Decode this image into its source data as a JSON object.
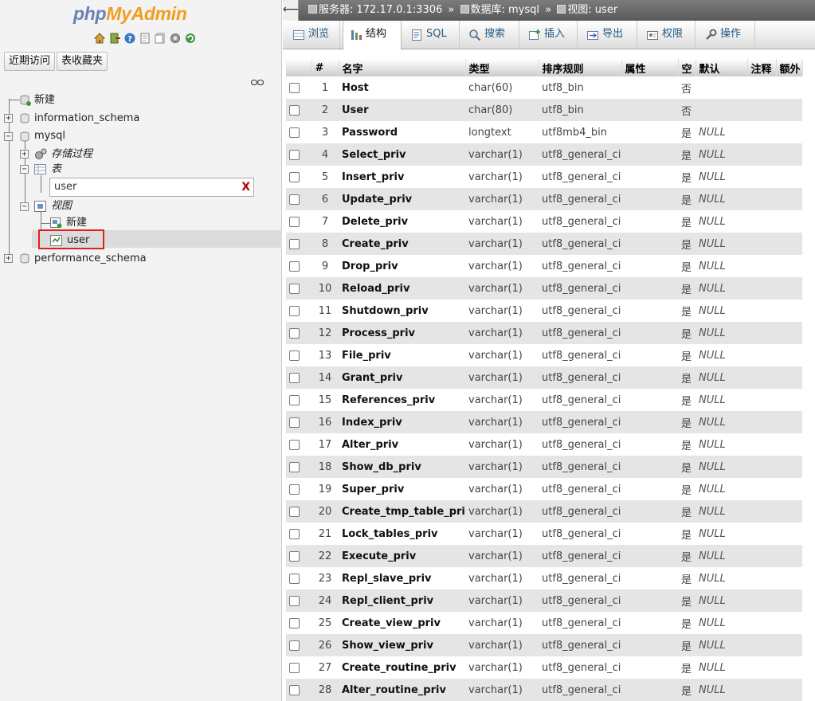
{
  "logo": {
    "part1": "php",
    "part2": "MyAdmin"
  },
  "nav_icons": [
    "home-icon",
    "exit-icon",
    "help-icon",
    "docs-icon",
    "sql-docs-icon",
    "settings-icon",
    "reload-icon"
  ],
  "quick_buttons": {
    "recent": "近期访问",
    "favorites": "表收藏夹"
  },
  "tree": {
    "new_db": "新建",
    "db_information_schema": "information_schema",
    "db_mysql": "mysql",
    "procedures": "存储过程",
    "tables": "表",
    "filter_value": "user",
    "filter_clear": "X",
    "views": "视图",
    "new_view": "新建",
    "view_user": "user",
    "db_performance_schema": "performance_schema"
  },
  "breadcrumb": {
    "server": "服务器: 172.17.0.1:3306",
    "database": "数据库: mysql",
    "view": "视图: user",
    "separator": "»"
  },
  "tabs": [
    {
      "label": "浏览",
      "icon": "browse-icon"
    },
    {
      "label": "结构",
      "icon": "structure-icon",
      "active": true
    },
    {
      "label": "SQL",
      "icon": "sql-icon"
    },
    {
      "label": "搜索",
      "icon": "search-icon"
    },
    {
      "label": "插入",
      "icon": "insert-icon"
    },
    {
      "label": "导出",
      "icon": "export-icon"
    },
    {
      "label": "权限",
      "icon": "privileges-icon"
    },
    {
      "label": "操作",
      "icon": "operations-icon"
    }
  ],
  "table_headers": [
    "#",
    "名字",
    "类型",
    "排序规则",
    "属性",
    "空",
    "默认",
    "注释",
    "额外"
  ],
  "rows": [
    {
      "n": "1",
      "name": "Host",
      "type": "char(60)",
      "collation": "utf8_bin",
      "null": "否",
      "default": ""
    },
    {
      "n": "2",
      "name": "User",
      "type": "char(80)",
      "collation": "utf8_bin",
      "null": "否",
      "default": ""
    },
    {
      "n": "3",
      "name": "Password",
      "type": "longtext",
      "collation": "utf8mb4_bin",
      "null": "是",
      "default": "NULL"
    },
    {
      "n": "4",
      "name": "Select_priv",
      "type": "varchar(1)",
      "collation": "utf8_general_ci",
      "null": "是",
      "default": "NULL"
    },
    {
      "n": "5",
      "name": "Insert_priv",
      "type": "varchar(1)",
      "collation": "utf8_general_ci",
      "null": "是",
      "default": "NULL"
    },
    {
      "n": "6",
      "name": "Update_priv",
      "type": "varchar(1)",
      "collation": "utf8_general_ci",
      "null": "是",
      "default": "NULL"
    },
    {
      "n": "7",
      "name": "Delete_priv",
      "type": "varchar(1)",
      "collation": "utf8_general_ci",
      "null": "是",
      "default": "NULL"
    },
    {
      "n": "8",
      "name": "Create_priv",
      "type": "varchar(1)",
      "collation": "utf8_general_ci",
      "null": "是",
      "default": "NULL"
    },
    {
      "n": "9",
      "name": "Drop_priv",
      "type": "varchar(1)",
      "collation": "utf8_general_ci",
      "null": "是",
      "default": "NULL"
    },
    {
      "n": "10",
      "name": "Reload_priv",
      "type": "varchar(1)",
      "collation": "utf8_general_ci",
      "null": "是",
      "default": "NULL"
    },
    {
      "n": "11",
      "name": "Shutdown_priv",
      "type": "varchar(1)",
      "collation": "utf8_general_ci",
      "null": "是",
      "default": "NULL"
    },
    {
      "n": "12",
      "name": "Process_priv",
      "type": "varchar(1)",
      "collation": "utf8_general_ci",
      "null": "是",
      "default": "NULL"
    },
    {
      "n": "13",
      "name": "File_priv",
      "type": "varchar(1)",
      "collation": "utf8_general_ci",
      "null": "是",
      "default": "NULL"
    },
    {
      "n": "14",
      "name": "Grant_priv",
      "type": "varchar(1)",
      "collation": "utf8_general_ci",
      "null": "是",
      "default": "NULL"
    },
    {
      "n": "15",
      "name": "References_priv",
      "type": "varchar(1)",
      "collation": "utf8_general_ci",
      "null": "是",
      "default": "NULL"
    },
    {
      "n": "16",
      "name": "Index_priv",
      "type": "varchar(1)",
      "collation": "utf8_general_ci",
      "null": "是",
      "default": "NULL"
    },
    {
      "n": "17",
      "name": "Alter_priv",
      "type": "varchar(1)",
      "collation": "utf8_general_ci",
      "null": "是",
      "default": "NULL"
    },
    {
      "n": "18",
      "name": "Show_db_priv",
      "type": "varchar(1)",
      "collation": "utf8_general_ci",
      "null": "是",
      "default": "NULL"
    },
    {
      "n": "19",
      "name": "Super_priv",
      "type": "varchar(1)",
      "collation": "utf8_general_ci",
      "null": "是",
      "default": "NULL"
    },
    {
      "n": "20",
      "name": "Create_tmp_table_priv",
      "type": "varchar(1)",
      "collation": "utf8_general_ci",
      "null": "是",
      "default": "NULL"
    },
    {
      "n": "21",
      "name": "Lock_tables_priv",
      "type": "varchar(1)",
      "collation": "utf8_general_ci",
      "null": "是",
      "default": "NULL"
    },
    {
      "n": "22",
      "name": "Execute_priv",
      "type": "varchar(1)",
      "collation": "utf8_general_ci",
      "null": "是",
      "default": "NULL"
    },
    {
      "n": "23",
      "name": "Repl_slave_priv",
      "type": "varchar(1)",
      "collation": "utf8_general_ci",
      "null": "是",
      "default": "NULL"
    },
    {
      "n": "24",
      "name": "Repl_client_priv",
      "type": "varchar(1)",
      "collation": "utf8_general_ci",
      "null": "是",
      "default": "NULL"
    },
    {
      "n": "25",
      "name": "Create_view_priv",
      "type": "varchar(1)",
      "collation": "utf8_general_ci",
      "null": "是",
      "default": "NULL"
    },
    {
      "n": "26",
      "name": "Show_view_priv",
      "type": "varchar(1)",
      "collation": "utf8_general_ci",
      "null": "是",
      "default": "NULL"
    },
    {
      "n": "27",
      "name": "Create_routine_priv",
      "type": "varchar(1)",
      "collation": "utf8_general_ci",
      "null": "是",
      "default": "NULL"
    },
    {
      "n": "28",
      "name": "Alter_routine_priv",
      "type": "varchar(1)",
      "collation": "utf8_general_ci",
      "null": "是",
      "default": "NULL"
    }
  ],
  "colors": {
    "logo_php": "#6c7eb7",
    "logo_myadmin": "#f29d1e",
    "link": "#235a81",
    "highlight": "#e02020"
  }
}
